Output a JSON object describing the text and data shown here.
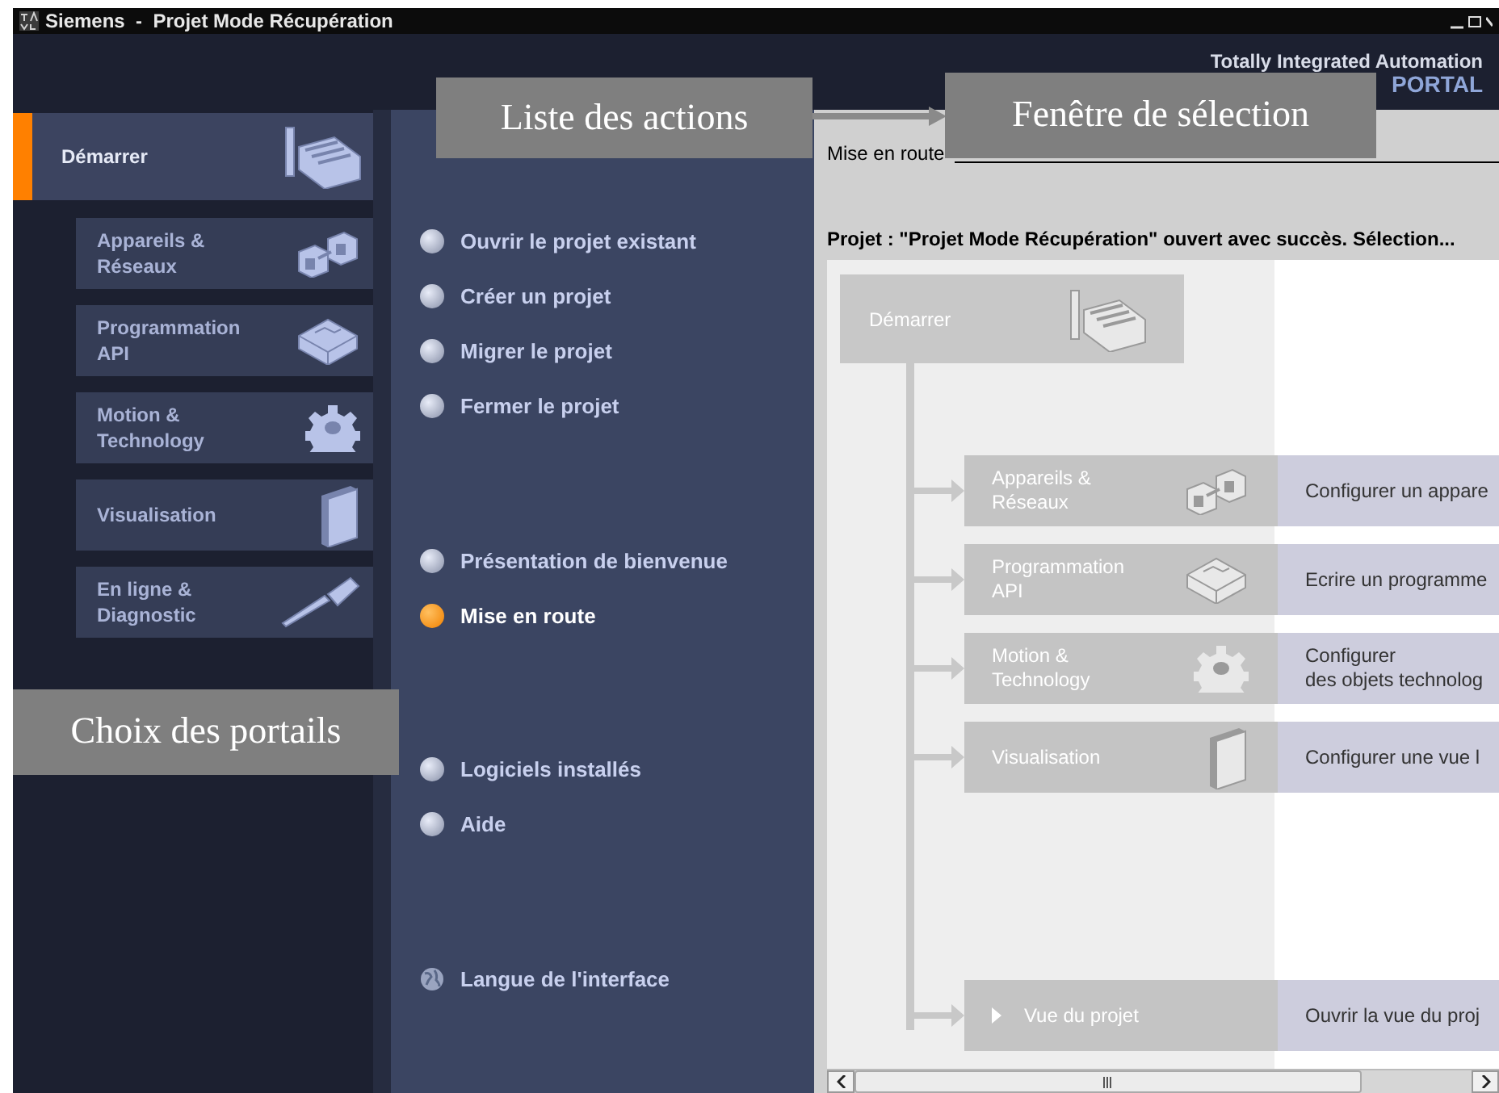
{
  "window": {
    "title": "Siemens  -  Projet Mode Récupération"
  },
  "brand": {
    "line1": "Totally Integrated Automation",
    "line2": "PORTAL"
  },
  "portals": {
    "main": {
      "label": "Démarrer",
      "kind": "start",
      "selected": true
    },
    "items": [
      {
        "label": "Appareils &\nRéseaux",
        "kind": "devices",
        "selected": false
      },
      {
        "label": "Programmation\nAPI",
        "kind": "program",
        "selected": false
      },
      {
        "label": "Motion &\nTechnology",
        "kind": "gear",
        "selected": false
      },
      {
        "label": "Visualisation",
        "kind": "screen",
        "selected": false
      },
      {
        "label": "En ligne &\nDiagnostic",
        "kind": "tool",
        "selected": false
      }
    ]
  },
  "action_groups": [
    {
      "items": [
        {
          "label": "Ouvrir le projet existant",
          "kind": "bullet",
          "selected": false
        },
        {
          "label": "Créer un projet",
          "kind": "bullet",
          "selected": false
        },
        {
          "label": "Migrer le projet",
          "kind": "bullet",
          "selected": false
        },
        {
          "label": "Fermer le projet",
          "kind": "bullet",
          "selected": false
        }
      ]
    },
    {
      "items": [
        {
          "label": "Présentation de bienvenue",
          "kind": "bullet",
          "selected": false
        },
        {
          "label": "Mise en route",
          "kind": "bullet",
          "selected": true
        }
      ]
    },
    {
      "items": [
        {
          "label": "Logiciels installés",
          "kind": "bullet",
          "selected": false
        },
        {
          "label": "Aide",
          "kind": "bullet",
          "selected": false
        }
      ]
    },
    {
      "items": [
        {
          "label": "Langue de l'interface",
          "kind": "globe",
          "selected": false
        }
      ]
    }
  ],
  "selection": {
    "section_title": "Mise en route",
    "status": "Projet : \"Projet Mode Récupération\" ouvert avec succès. Sélection...",
    "start_node": {
      "label": "Démarrer",
      "kind": "start"
    },
    "steps": [
      {
        "label": "Appareils &\nRéseaux",
        "description": "Configurer un appare",
        "kind": "devices"
      },
      {
        "label": "Programmation\nAPI",
        "description": "Ecrire un programme",
        "kind": "program"
      },
      {
        "label": "Motion &\nTechnology",
        "description": "Configurer\ndes objets technolog",
        "kind": "gear"
      },
      {
        "label": "Visualisation",
        "description": "Configurer une vue l",
        "kind": "screen"
      },
      {
        "label": "Vue du projet",
        "description": "Ouvrir la vue du proj",
        "kind": "link"
      }
    ]
  },
  "annotations": [
    {
      "text": "Liste des actions",
      "kind": "actions"
    },
    {
      "text": "Fenêtre de sélection",
      "kind": "selection"
    },
    {
      "text": "Choix des portails",
      "kind": "portals"
    }
  ]
}
